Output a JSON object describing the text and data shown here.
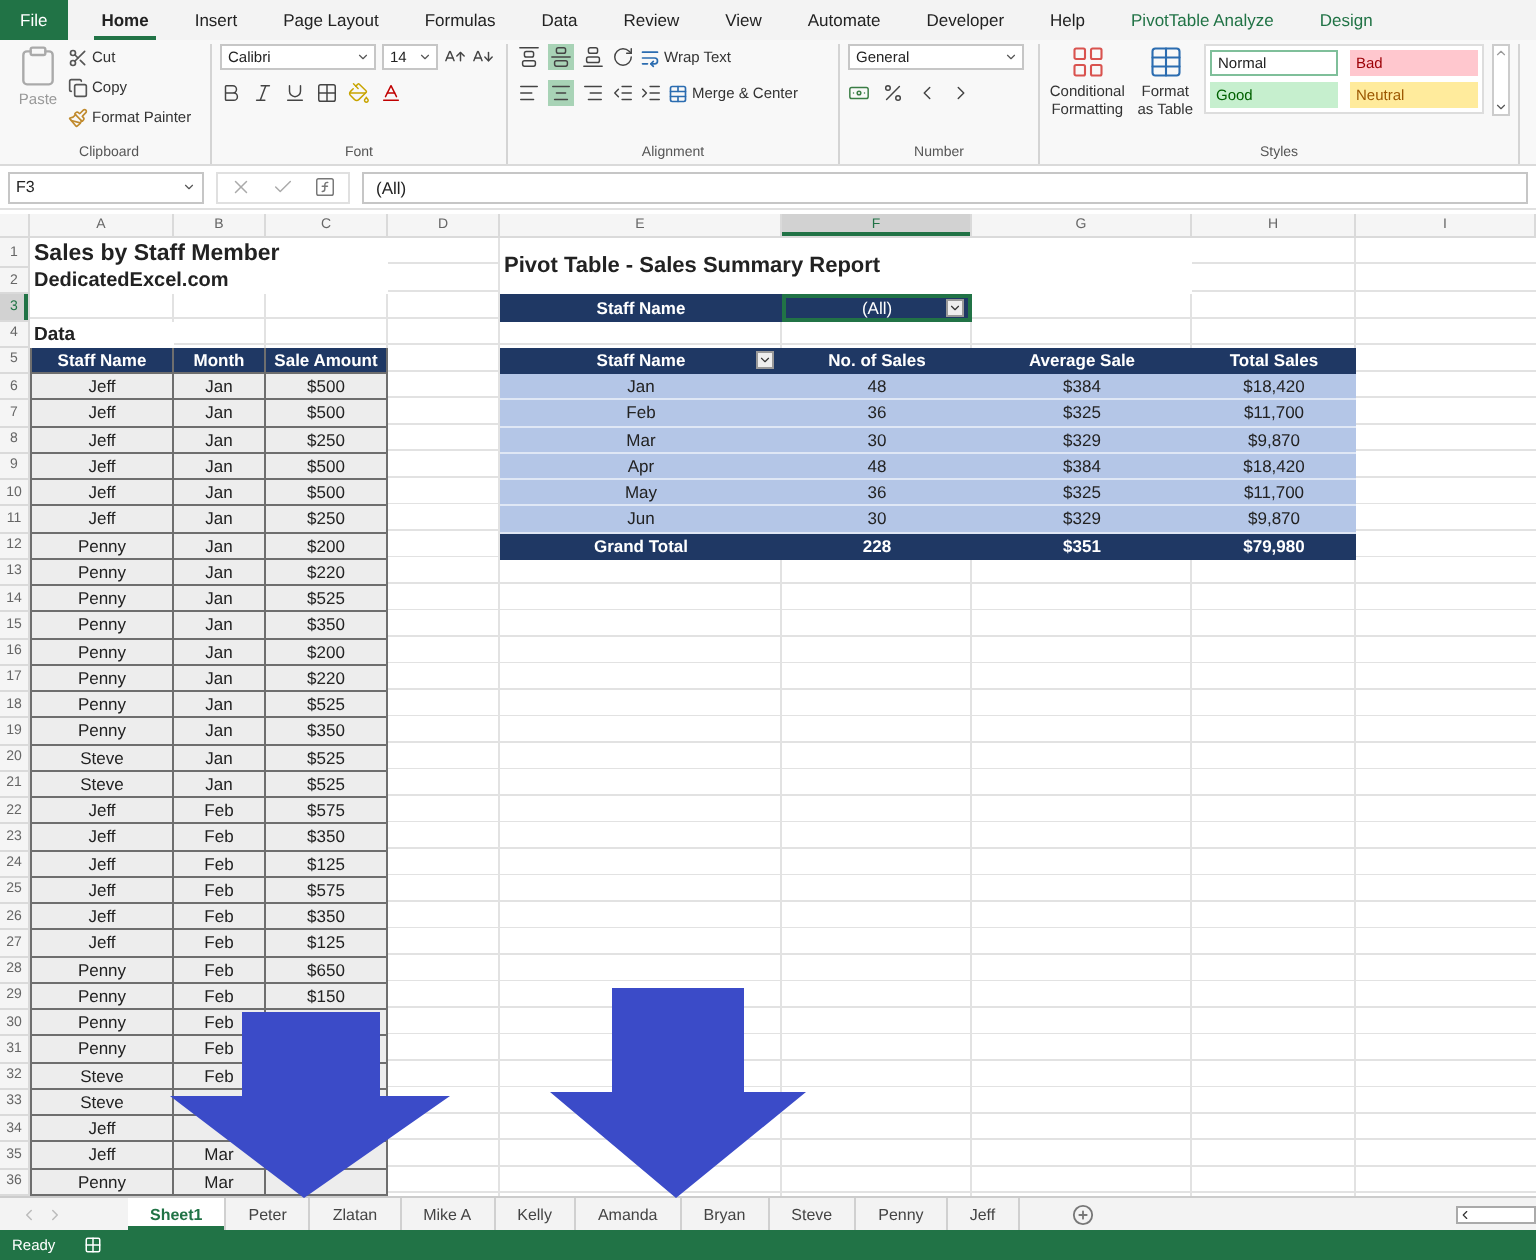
{
  "menu_tabs": [
    {
      "label": "File",
      "kind": "file",
      "selected": false
    },
    {
      "label": "Home",
      "kind": "tab",
      "selected": true
    },
    {
      "label": "Insert",
      "kind": "tab",
      "selected": false
    },
    {
      "label": "Page Layout",
      "kind": "tab",
      "selected": false
    },
    {
      "label": "Formulas",
      "kind": "tab",
      "selected": false
    },
    {
      "label": "Data",
      "kind": "tab",
      "selected": false
    },
    {
      "label": "Review",
      "kind": "tab",
      "selected": false
    },
    {
      "label": "View",
      "kind": "tab",
      "selected": false
    },
    {
      "label": "Automate",
      "kind": "tab",
      "selected": false
    },
    {
      "label": "Developer",
      "kind": "tab",
      "selected": false
    },
    {
      "label": "Help",
      "kind": "tab",
      "selected": false
    },
    {
      "label": "PivotTable Analyze",
      "kind": "contextual",
      "selected": false
    },
    {
      "label": "Design",
      "kind": "contextual",
      "selected": false
    }
  ],
  "ribbon": {
    "clipboard": {
      "paste": "Paste",
      "cut": "Cut",
      "copy": "Copy",
      "format_painter": "Format Painter",
      "label": "Clipboard"
    },
    "font": {
      "name": "Calibri",
      "size": "14",
      "label": "Font"
    },
    "alignment": {
      "vertical": [
        {
          "kind": "top",
          "selected": false
        },
        {
          "kind": "middle",
          "selected": true
        },
        {
          "kind": "bottom",
          "selected": false
        }
      ],
      "horizontal": [
        {
          "kind": "left",
          "selected": false
        },
        {
          "kind": "center",
          "selected": true
        },
        {
          "kind": "right",
          "selected": false
        }
      ],
      "wrap_text": "Wrap Text",
      "merge": "Merge & Center",
      "label": "Alignment"
    },
    "number": {
      "format": "General",
      "label": "Number"
    },
    "styles": {
      "conditional": "Conditional Formatting",
      "format_table": "Format as Table",
      "label": "Styles",
      "cells": [
        {
          "label": "Normal",
          "kind": "normal"
        },
        {
          "label": "Bad",
          "kind": "bad"
        },
        {
          "label": "Good",
          "kind": "good"
        },
        {
          "label": "Neutral",
          "kind": "neutral"
        }
      ]
    }
  },
  "formula_bar": {
    "name_box": "F3",
    "formula": "(All)"
  },
  "columns": [
    {
      "label": "A",
      "selected": false
    },
    {
      "label": "B",
      "selected": false
    },
    {
      "label": "C",
      "selected": false
    },
    {
      "label": "D",
      "selected": false
    },
    {
      "label": "E",
      "selected": false
    },
    {
      "label": "F",
      "selected": true
    },
    {
      "label": "G",
      "selected": false
    },
    {
      "label": "H",
      "selected": false
    },
    {
      "label": "I",
      "selected": false
    }
  ],
  "row_headers": [
    {
      "label": "1",
      "selected": false
    },
    {
      "label": "2",
      "selected": false
    },
    {
      "label": "3",
      "selected": true
    },
    {
      "label": "4",
      "selected": false
    },
    {
      "label": "5",
      "selected": false
    },
    {
      "label": "6",
      "selected": false
    },
    {
      "label": "7",
      "selected": false
    },
    {
      "label": "8",
      "selected": false
    },
    {
      "label": "9",
      "selected": false
    },
    {
      "label": "10",
      "selected": false
    },
    {
      "label": "11",
      "selected": false
    },
    {
      "label": "12",
      "selected": false
    },
    {
      "label": "13",
      "selected": false
    },
    {
      "label": "14",
      "selected": false
    },
    {
      "label": "15",
      "selected": false
    },
    {
      "label": "16",
      "selected": false
    },
    {
      "label": "17",
      "selected": false
    },
    {
      "label": "18",
      "selected": false
    },
    {
      "label": "19",
      "selected": false
    },
    {
      "label": "20",
      "selected": false
    },
    {
      "label": "21",
      "selected": false
    },
    {
      "label": "22",
      "selected": false
    },
    {
      "label": "23",
      "selected": false
    },
    {
      "label": "24",
      "selected": false
    },
    {
      "label": "25",
      "selected": false
    },
    {
      "label": "26",
      "selected": false
    },
    {
      "label": "27",
      "selected": false
    },
    {
      "label": "28",
      "selected": false
    },
    {
      "label": "29",
      "selected": false
    },
    {
      "label": "30",
      "selected": false
    },
    {
      "label": "31",
      "selected": false
    },
    {
      "label": "32",
      "selected": false
    },
    {
      "label": "33",
      "selected": false
    },
    {
      "label": "34",
      "selected": false
    },
    {
      "label": "35",
      "selected": false
    },
    {
      "label": "36",
      "selected": false
    }
  ],
  "sheet": {
    "title": "Sales by Staff Member",
    "subtitle": "DedicatedExcel.com",
    "section": "Data",
    "data_table": {
      "columns": [
        "Staff Name",
        "Month",
        "Sale Amount"
      ],
      "rows": [
        {
          "staff": "Jeff",
          "month": "Jan",
          "amount": "$500"
        },
        {
          "staff": "Jeff",
          "month": "Jan",
          "amount": "$500"
        },
        {
          "staff": "Jeff",
          "month": "Jan",
          "amount": "$250"
        },
        {
          "staff": "Jeff",
          "month": "Jan",
          "amount": "$500"
        },
        {
          "staff": "Jeff",
          "month": "Jan",
          "amount": "$500"
        },
        {
          "staff": "Jeff",
          "month": "Jan",
          "amount": "$250"
        },
        {
          "staff": "Penny",
          "month": "Jan",
          "amount": "$200"
        },
        {
          "staff": "Penny",
          "month": "Jan",
          "amount": "$220"
        },
        {
          "staff": "Penny",
          "month": "Jan",
          "amount": "$525"
        },
        {
          "staff": "Penny",
          "month": "Jan",
          "amount": "$350"
        },
        {
          "staff": "Penny",
          "month": "Jan",
          "amount": "$200"
        },
        {
          "staff": "Penny",
          "month": "Jan",
          "amount": "$220"
        },
        {
          "staff": "Penny",
          "month": "Jan",
          "amount": "$525"
        },
        {
          "staff": "Penny",
          "month": "Jan",
          "amount": "$350"
        },
        {
          "staff": "Steve",
          "month": "Jan",
          "amount": "$525"
        },
        {
          "staff": "Steve",
          "month": "Jan",
          "amount": "$525"
        },
        {
          "staff": "Jeff",
          "month": "Feb",
          "amount": "$575"
        },
        {
          "staff": "Jeff",
          "month": "Feb",
          "amount": "$350"
        },
        {
          "staff": "Jeff",
          "month": "Feb",
          "amount": "$125"
        },
        {
          "staff": "Jeff",
          "month": "Feb",
          "amount": "$575"
        },
        {
          "staff": "Jeff",
          "month": "Feb",
          "amount": "$350"
        },
        {
          "staff": "Jeff",
          "month": "Feb",
          "amount": "$125"
        },
        {
          "staff": "Penny",
          "month": "Feb",
          "amount": "$650"
        },
        {
          "staff": "Penny",
          "month": "Feb",
          "amount": "$150"
        },
        {
          "staff": "Penny",
          "month": "Feb"
        },
        {
          "staff": "Penny",
          "month": "Feb"
        },
        {
          "staff": "Steve",
          "month": "Feb"
        },
        {
          "staff": "Steve"
        },
        {
          "staff": "Jeff"
        },
        {
          "staff": "Jeff",
          "month": "Mar"
        },
        {
          "staff": "Penny",
          "month": "Mar"
        }
      ]
    }
  },
  "pivot": {
    "title": "Pivot Table - Sales Summary Report",
    "filter": {
      "label": "Staff Name",
      "value": "(All)",
      "selected": true
    },
    "columns": [
      "Staff Name",
      "No. of Sales",
      "Average Sale",
      "Total Sales"
    ],
    "rows": [
      [
        "Jan",
        "48",
        "$384",
        "$18,420"
      ],
      [
        "Feb",
        "36",
        "$325",
        "$11,700"
      ],
      [
        "Mar",
        "30",
        "$329",
        "$9,870"
      ],
      [
        "Apr",
        "48",
        "$384",
        "$18,420"
      ],
      [
        "May",
        "36",
        "$325",
        "$11,700"
      ],
      [
        "Jun",
        "30",
        "$329",
        "$9,870"
      ]
    ],
    "total": [
      "Grand Total",
      "228",
      "$351",
      "$79,980"
    ]
  },
  "sheet_tabs": [
    {
      "label": "Sheet1",
      "selected": true
    },
    {
      "label": "Peter",
      "selected": false
    },
    {
      "label": "Zlatan",
      "selected": false
    },
    {
      "label": "Mike A",
      "selected": false
    },
    {
      "label": "Kelly",
      "selected": false
    },
    {
      "label": "Amanda",
      "selected": false
    },
    {
      "label": "Bryan",
      "selected": false
    },
    {
      "label": "Steve",
      "selected": false
    },
    {
      "label": "Penny",
      "selected": false
    },
    {
      "label": "Jeff",
      "selected": false
    }
  ],
  "status_bar": {
    "status": "Ready"
  }
}
